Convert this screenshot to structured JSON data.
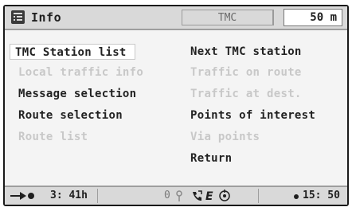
{
  "header": {
    "icon": "info-menu-icon",
    "title": "Info",
    "mode": "TMC",
    "scale": "50 m"
  },
  "menu": {
    "left": [
      {
        "label": "TMC Station list",
        "enabled": true,
        "selected": true
      },
      {
        "label": "Local traffic info",
        "enabled": false
      },
      {
        "label": "Message selection",
        "enabled": true
      },
      {
        "label": "Route selection",
        "enabled": true
      },
      {
        "label": "Route list",
        "enabled": false
      }
    ],
    "right": [
      {
        "label": "Next TMC station",
        "enabled": true
      },
      {
        "label": "Traffic on route",
        "enabled": false
      },
      {
        "label": "Traffic at dest.",
        "enabled": false
      },
      {
        "label": "Points of interest",
        "enabled": true
      },
      {
        "label": "Via points",
        "enabled": false
      },
      {
        "label": "Return",
        "enabled": true
      }
    ]
  },
  "status": {
    "route_icon": "arrow-to-destination-icon",
    "time_to_destination": "3: 41h",
    "indicator_number": "0",
    "indicator_icons": [
      "pin-icon",
      "phone-icon",
      "e-icon",
      "gps-icon"
    ],
    "clock_icon": "dot-icon",
    "clock": "15: 50"
  }
}
